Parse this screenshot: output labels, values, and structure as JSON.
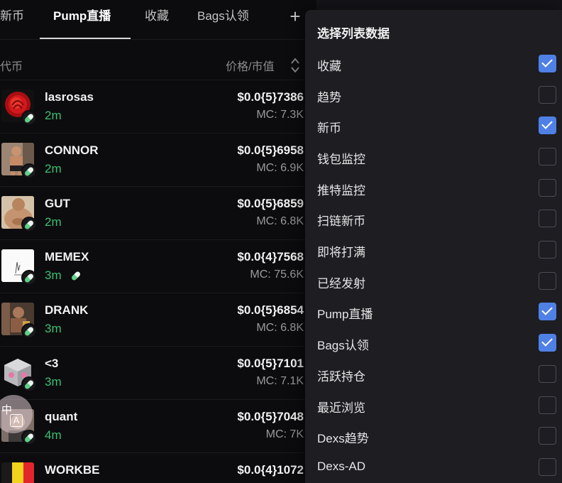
{
  "tabs": [
    {
      "label": "新币",
      "active": false
    },
    {
      "label": "Pump直播",
      "active": true
    },
    {
      "label": "收藏",
      "active": false
    },
    {
      "label": "Bags认领",
      "active": false
    }
  ],
  "add_tab_label": "+",
  "list_header": {
    "token_col": "代币",
    "price_col": "价格/市值"
  },
  "tokens": [
    {
      "name": "lasrosas",
      "age": "2m",
      "price": "$0.0{5}7386",
      "mc": "MC: 7.3K",
      "avatar": "rose-image"
    },
    {
      "name": "CONNOR",
      "age": "2m",
      "price": "$0.0{5}6958",
      "mc": "MC: 6.9K",
      "avatar": "person-image"
    },
    {
      "name": "GUT",
      "age": "2m",
      "price": "$0.0{5}6859",
      "mc": "MC: 6.8K",
      "avatar": "person-image"
    },
    {
      "name": "MEMEX",
      "age": "3m",
      "price": "$0.0{4}7568",
      "mc": "MC: 75.6K",
      "avatar": "sketch-image"
    },
    {
      "name": "DRANK",
      "age": "3m",
      "price": "$0.0{5}6854",
      "mc": "MC: 6.8K",
      "avatar": "person-image"
    },
    {
      "name": "<3",
      "age": "3m",
      "price": "$0.0{5}7101",
      "mc": "MC: 7.1K",
      "avatar": "cube-image"
    },
    {
      "name": "quant",
      "age": "4m",
      "price": "$0.0{5}7048",
      "mc": "MC: 7K",
      "avatar": "portrait-image"
    },
    {
      "name": "WORKBE",
      "age": "",
      "price": "$0.0{4}1072",
      "mc": "",
      "avatar": "flag-image"
    }
  ],
  "lang_button": {
    "top": "中",
    "bottom": "A"
  },
  "panel": {
    "title": "选择列表数据",
    "options": [
      {
        "label": "收藏",
        "checked": true
      },
      {
        "label": "趋势",
        "checked": false
      },
      {
        "label": "新币",
        "checked": true
      },
      {
        "label": "钱包监控",
        "checked": false
      },
      {
        "label": "推特监控",
        "checked": false
      },
      {
        "label": "扫链新币",
        "checked": false
      },
      {
        "label": "即将打满",
        "checked": false
      },
      {
        "label": "已经发射",
        "checked": false
      },
      {
        "label": "Pump直播",
        "checked": true
      },
      {
        "label": "Bags认领",
        "checked": true
      },
      {
        "label": "活跃持仓",
        "checked": false
      },
      {
        "label": "最近浏览",
        "checked": false
      },
      {
        "label": "Dexs趋势",
        "checked": false
      },
      {
        "label": "Dexs-AD",
        "checked": false
      }
    ]
  },
  "colors": {
    "accent": "#4f80e6",
    "age_green": "#3cbf73",
    "panel_bg": "#1d1d22",
    "page_bg": "#0c0c0e"
  }
}
